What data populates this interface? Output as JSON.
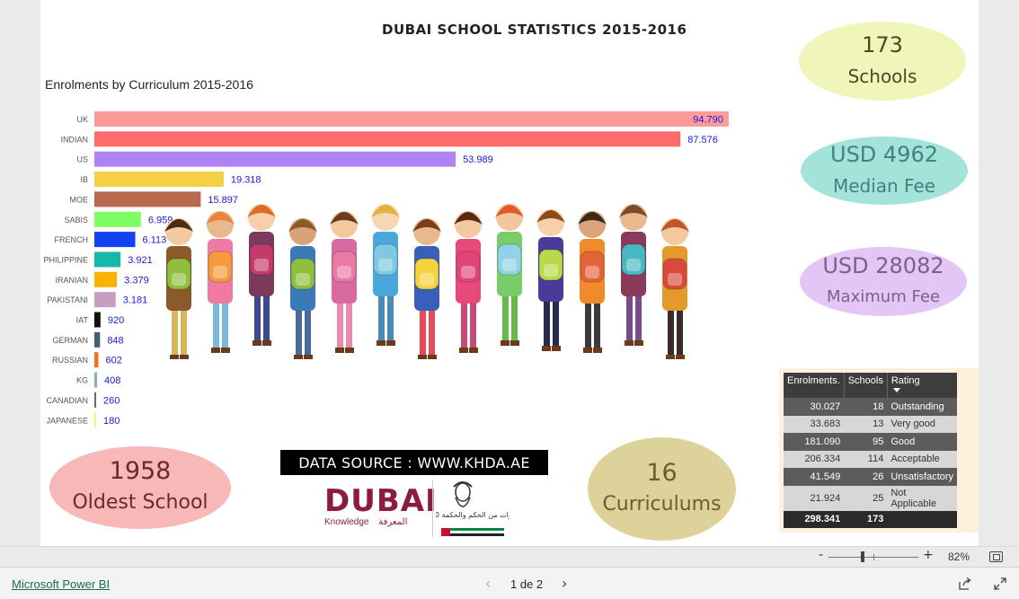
{
  "report": {
    "title": "DUBAI SCHOOL STATISTICS 2015-2016",
    "data_source": "DATA SOURCE : WWW.KHDA.AE"
  },
  "chart_data": {
    "type": "bar",
    "orientation": "horizontal",
    "title": "Enrolments by Curriculum 2015-2016",
    "categories": [
      "UK",
      "INDIAN",
      "US",
      "IB",
      "MOE",
      "SABIS",
      "FRENCH",
      "PHILIPPINE",
      "IRANIAN",
      "PAKISTANI",
      "IAT",
      "GERMAN",
      "RUSSIAN",
      "KG",
      "CANADIAN",
      "JAPANESE"
    ],
    "values": [
      94790,
      87576,
      53989,
      19318,
      15897,
      6959,
      6113,
      3921,
      3379,
      3181,
      920,
      848,
      602,
      408,
      260,
      180
    ],
    "value_labels": [
      "94.790",
      "87.576",
      "53.989",
      "19.318",
      "15.897",
      "6.959",
      "6.113",
      "3.921",
      "3.379",
      "3.181",
      "920",
      "848",
      "602",
      "408",
      "260",
      "180"
    ],
    "colors": [
      "#fd9b9b",
      "#fd6b6b",
      "#b083f5",
      "#f5cf45",
      "#b9694d",
      "#7dff63",
      "#1243f0",
      "#16b8aa",
      "#fbb104",
      "#c99cc2",
      "#111111",
      "#3c6377",
      "#ff6a1f",
      "#86adc2",
      "#7e5c6a",
      "#fff36b"
    ],
    "label_color": "#1a1ad4",
    "xlim": [
      0,
      100000
    ],
    "grid": false,
    "legend": "none"
  },
  "kpis": {
    "schools": {
      "value": "173",
      "label": "Schools",
      "color": "#f0f5b9",
      "text_color": "#4a4a22"
    },
    "median_fee": {
      "value": "USD 4962",
      "label": "Median Fee",
      "color": "#a3e3da",
      "text_color": "#3d857c"
    },
    "max_fee": {
      "value": "USD  28082",
      "label": "Maximum Fee",
      "color": "#e4c6f6",
      "text_color": "#7a5f92"
    },
    "oldest": {
      "value": "1958",
      "label": "Oldest School",
      "color": "#f7b8b8",
      "text_color": "#6b2a2a"
    },
    "curriculums": {
      "value": "16",
      "label": "Curriculums",
      "color": "#ddd39a",
      "text_color": "#6a5f2c"
    }
  },
  "logos": {
    "dubai_word": "DUBAI",
    "knowledge": "Knowledge",
    "knowledge_ar": "المعرفة",
    "emblem_text": "10 سنوات من الحكم والحكمة"
  },
  "table": {
    "headers": [
      "Enrolments.",
      "Schools",
      "Rating"
    ],
    "rows": [
      {
        "enrolments": "30.027",
        "schools": "18",
        "rating": "Outstanding",
        "shade": "dark"
      },
      {
        "enrolments": "33.683",
        "schools": "13",
        "rating": "Very good",
        "shade": "light"
      },
      {
        "enrolments": "181.090",
        "schools": "95",
        "rating": "Good",
        "shade": "dark"
      },
      {
        "enrolments": "206.334",
        "schools": "114",
        "rating": "Acceptable",
        "shade": "light"
      },
      {
        "enrolments": "41.549",
        "schools": "26",
        "rating": "Unsatisfactory",
        "shade": "dark"
      },
      {
        "enrolments": "21.924",
        "schools": "25",
        "rating": "Not Applicable",
        "shade": "light"
      }
    ],
    "total": {
      "enrolments": "298.341",
      "schools": "173",
      "rating": ""
    }
  },
  "footer": {
    "app_link": "Microsoft Power BI",
    "page_indicator": "1 de 2",
    "zoom_percent": "82%",
    "zoom_minus": "-",
    "zoom_plus": "+",
    "zoom_level": 0.4
  }
}
